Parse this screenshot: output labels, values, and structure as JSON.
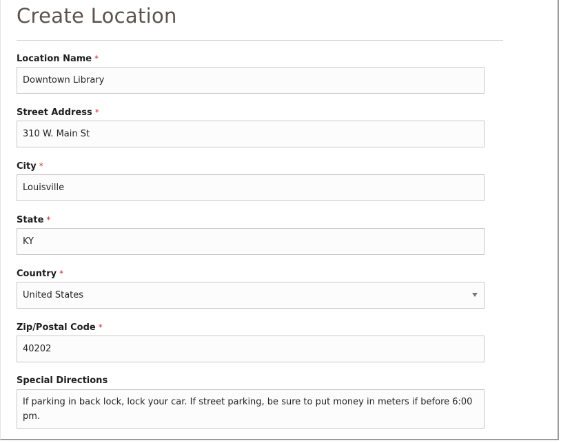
{
  "page": {
    "title": "Create Location"
  },
  "form": {
    "required_marker": "*",
    "location_name": {
      "label": "Location Name",
      "value": "Downtown Library"
    },
    "street_address": {
      "label": "Street Address",
      "value": "310 W. Main St"
    },
    "city": {
      "label": "City",
      "value": "Louisville"
    },
    "state": {
      "label": "State",
      "value": "KY"
    },
    "country": {
      "label": "Country",
      "value": "United States"
    },
    "zip": {
      "label": "Zip/Postal Code",
      "value": "40202"
    },
    "special_directions": {
      "label": "Special Directions",
      "value": "If parking in back lock, lock your car.  If street parking, be sure to put money in meters if before 6:00 pm."
    }
  },
  "icons": {
    "country_dropdown": "chevron-down-icon"
  }
}
